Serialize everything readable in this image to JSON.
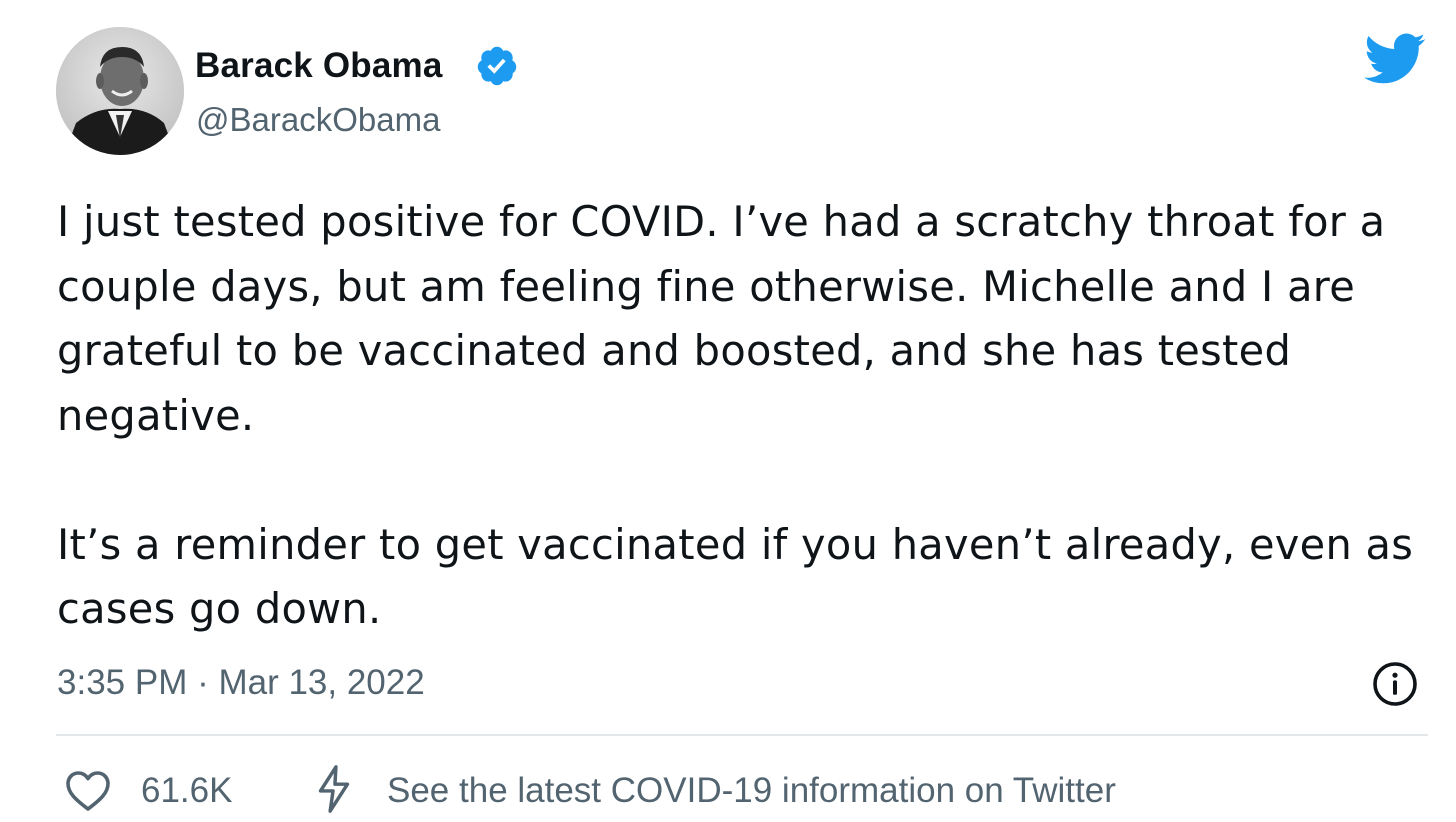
{
  "author": {
    "display_name": "Barack Obama",
    "handle": "@BarackObama",
    "verified_icon": "verified-badge-icon",
    "avatar": "profile-photo"
  },
  "brand_icon": "twitter-bird-icon",
  "tweet": {
    "paragraphs": [
      "I just tested positive for COVID. I’ve had a scratchy throat for a couple days, but am feeling fine otherwise. Michelle and I are grateful to be vaccinated and boosted, and she has tested negative.",
      "It’s a reminder to get vaccinated if you haven’t already, even as cases go down."
    ],
    "timestamp": "3:35 PM · Mar 13, 2022"
  },
  "actions": {
    "like_icon": "heart-icon",
    "like_count": "61.6K",
    "info_link_icon": "lightning-bolt-icon",
    "info_link_label": "See the latest COVID-19 information on Twitter"
  },
  "colors": {
    "twitter_blue": "#1d9bf0",
    "text_primary": "#0f1419",
    "text_secondary": "#536471"
  }
}
